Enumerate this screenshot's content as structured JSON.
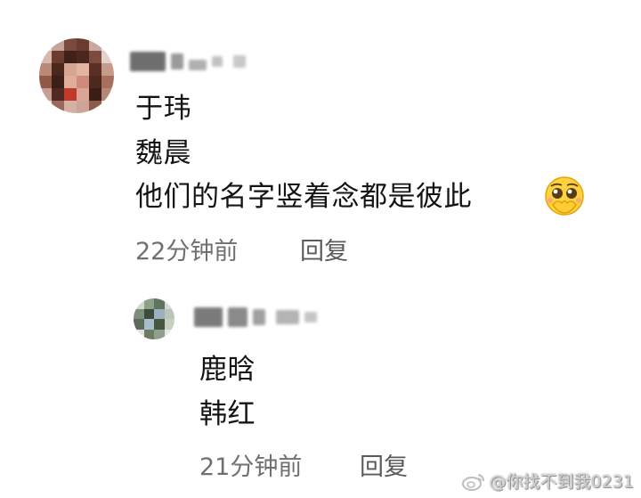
{
  "comment": {
    "lines": [
      "于玮",
      "魏晨",
      "他们的名字竖着念都是彼此"
    ],
    "emoji": "pleading-face-icon",
    "time": "22分钟前",
    "reply_label": "回复"
  },
  "reply": {
    "lines": [
      "鹿晗",
      "韩红"
    ],
    "time": "21分钟前",
    "reply_label": "回复"
  },
  "watermark": {
    "text": "@你找不到我0231",
    "icon": "weibo-icon"
  }
}
